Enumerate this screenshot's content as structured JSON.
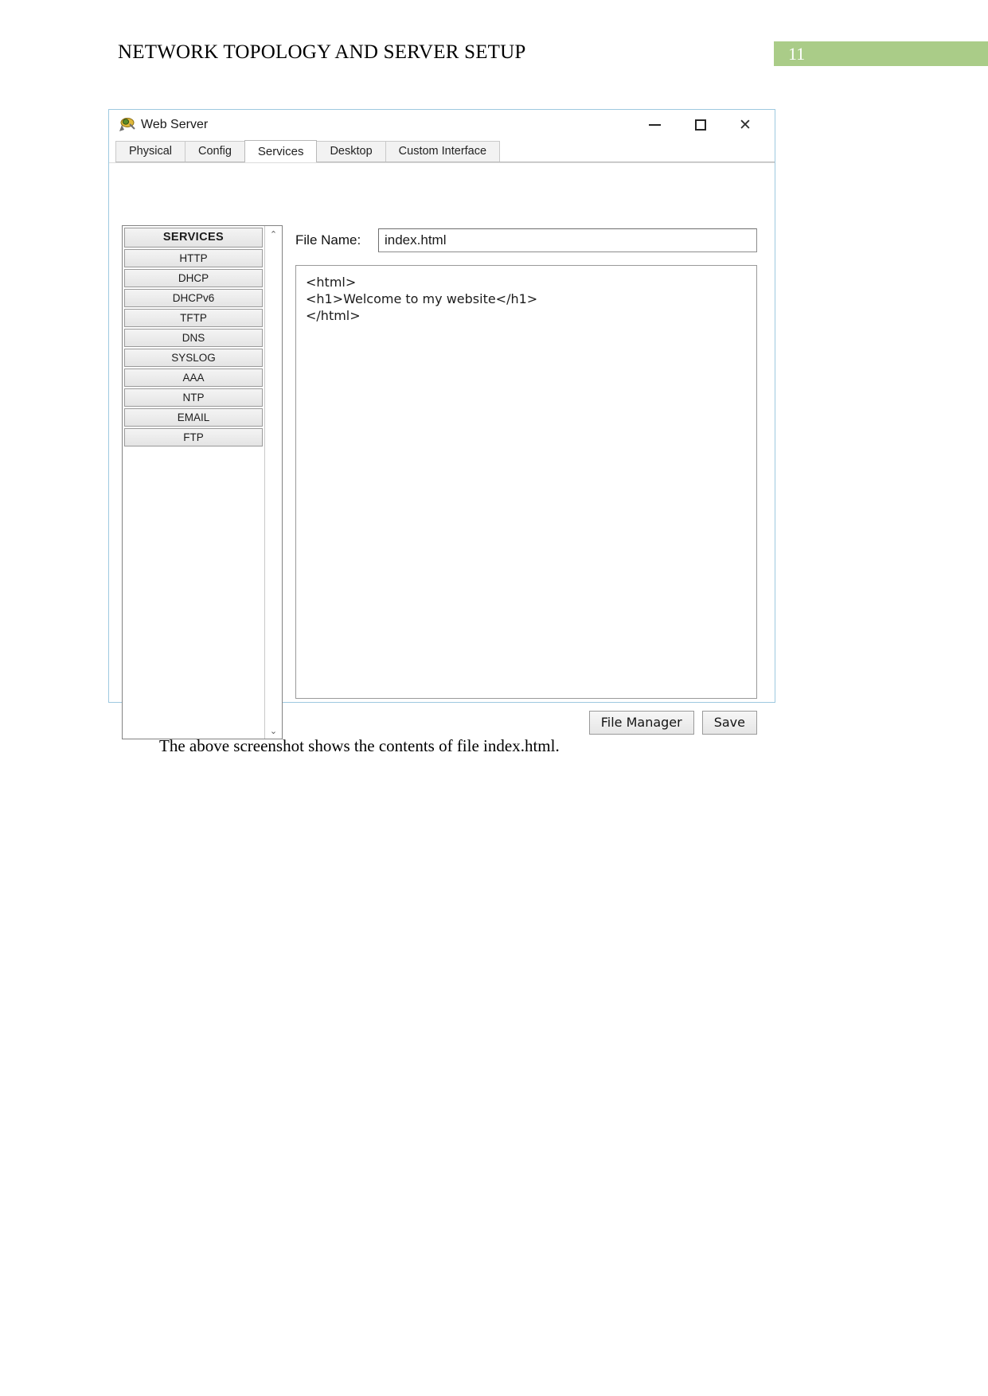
{
  "document": {
    "header_title": "NETWORK TOPOLOGY AND SERVER SETUP",
    "page_number": "11",
    "page_badge_color": "#aacc88",
    "caption": "The above screenshot shows the contents of file index.html."
  },
  "window": {
    "title": "Web Server",
    "icon": "server-icon",
    "controls": {
      "minimize": "─",
      "maximize": "□",
      "close": "✕"
    },
    "tabs": [
      {
        "label": "Physical",
        "active": false
      },
      {
        "label": "Config",
        "active": false
      },
      {
        "label": "Services",
        "active": true
      },
      {
        "label": "Desktop",
        "active": false
      },
      {
        "label": "Custom Interface",
        "active": false
      }
    ],
    "sidebar": {
      "header": "SERVICES",
      "items": [
        {
          "label": "HTTP"
        },
        {
          "label": "DHCP"
        },
        {
          "label": "DHCPv6"
        },
        {
          "label": "TFTP"
        },
        {
          "label": "DNS"
        },
        {
          "label": "SYSLOG"
        },
        {
          "label": "AAA"
        },
        {
          "label": "NTP"
        },
        {
          "label": "EMAIL"
        },
        {
          "label": "FTP"
        }
      ],
      "scroll_up": "⌃",
      "scroll_down": "⌄"
    },
    "form": {
      "filename_label": "File Name:",
      "filename_value": "index.html",
      "filename_placeholder": "index.html",
      "code_content": "<html>\n<h1>Welcome to my website</h1>\n</html>"
    },
    "buttons": {
      "file_manager": "File Manager",
      "save": "Save"
    }
  }
}
